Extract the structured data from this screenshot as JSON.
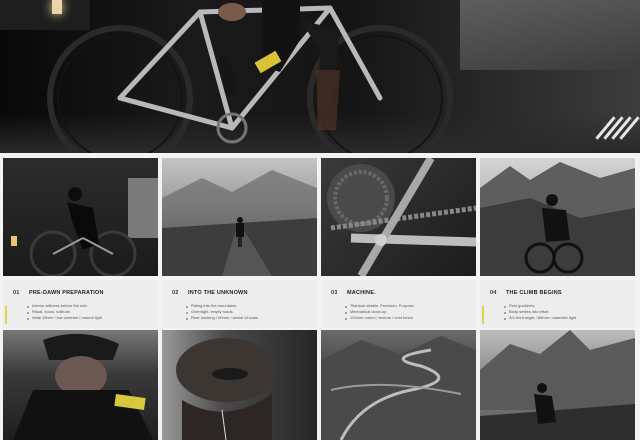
{
  "hero": {
    "photo_subject": "road-bike-on-indoor-trainer",
    "logo_icon": "diagonal-stripes-logo-icon"
  },
  "grid": {
    "cards": [
      {
        "number": "01",
        "title": "PRE-DAWN PREPARATION",
        "bullets": [
          "Interior stillness before the ride.",
          "Ritual, focus, solitude.",
          "Wide 35mm / low contrast / natural light"
        ],
        "photo_icon": "rider-silhouette-icon"
      },
      {
        "number": "02",
        "title": "INTO THE UNKNOWN",
        "bullets": [
          "Riding into the mountains.",
          "Overnight, empty roads.",
          "Rear tracking / 50mm / sense of scale"
        ],
        "photo_icon": "mountain-road-icon"
      },
      {
        "number": "03",
        "title": "MACHINE.",
        "bullets": [
          "Titanium details. Precision. Purpose.",
          "Mechanical close-up.",
          "100mm macro / texture / cold tones"
        ],
        "photo_icon": "chain-gear-icon"
      },
      {
        "number": "04",
        "title": "THE CLIMB BEGINS",
        "bullets": [
          "First gradients.",
          "Body settles into effort.",
          "3/4 front angle / 85mm / dramatic light"
        ],
        "photo_icon": "climbing-rider-icon"
      }
    ],
    "bottom_row_icons": [
      "rider-effort-icon",
      "face-closeup-icon",
      "serpentine-road-icon",
      "cliff-rider-icon"
    ]
  }
}
